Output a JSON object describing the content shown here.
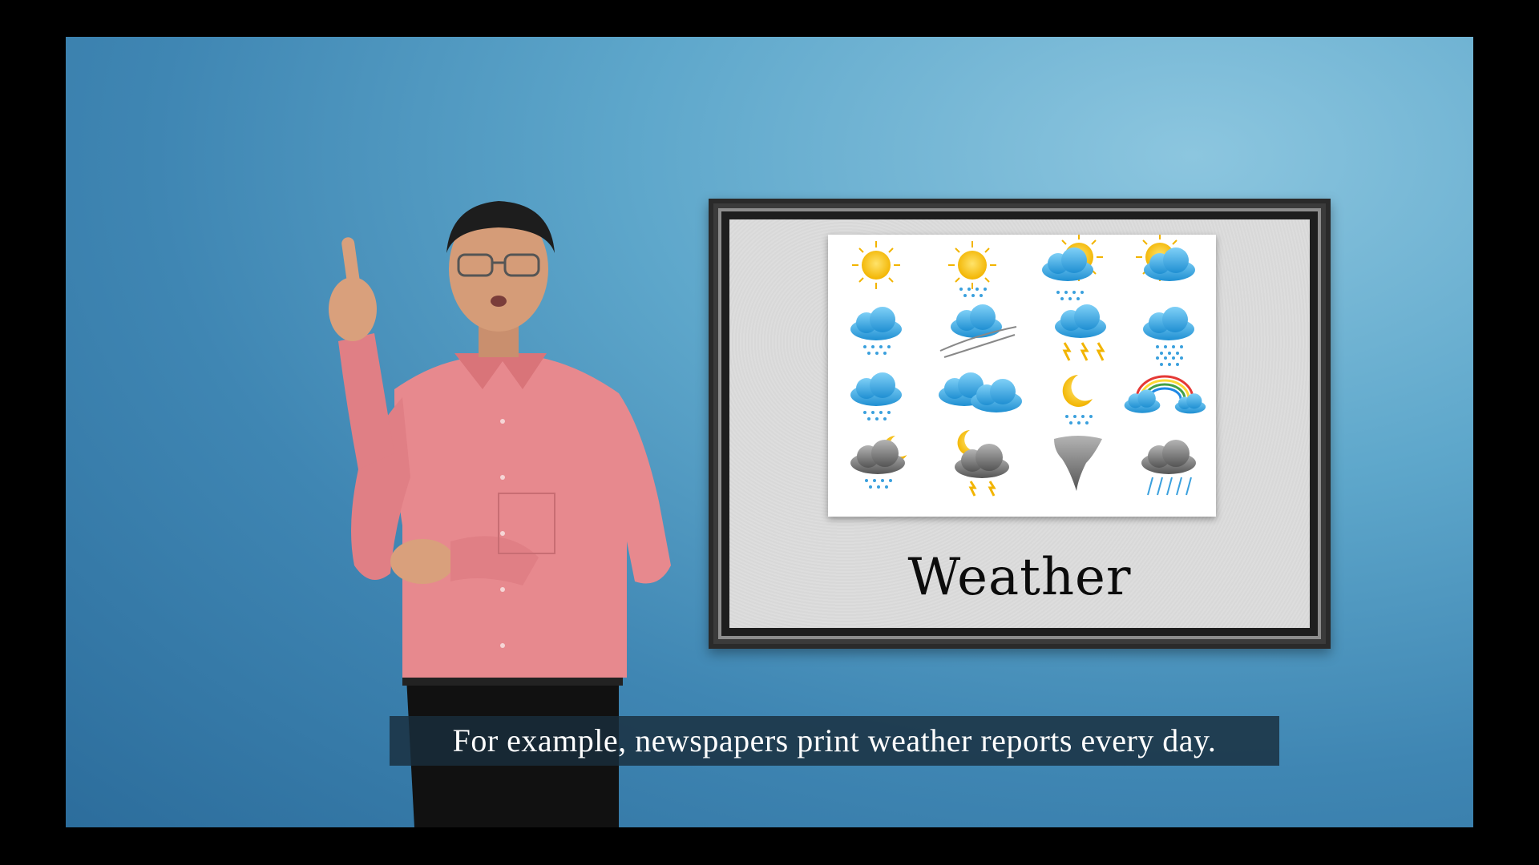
{
  "board": {
    "title": "Weather",
    "icons": [
      "sun-icon",
      "sun-snow-icon",
      "sun-cloud-snow-icon",
      "sun-cloud-icon",
      "cloud-rain-icon",
      "cloud-wind-icon",
      "cloud-lightning-icon",
      "cloud-rain-heavy-icon",
      "cloud-snow-icon",
      "clouds-icon",
      "moon-snow-icon",
      "rainbow-cloud-icon",
      "moon-dark-cloud-rain-icon",
      "moon-storm-cloud-icon",
      "tornado-icon",
      "dark-cloud-heavy-rain-icon"
    ]
  },
  "caption": {
    "text": "For example, newspapers print weather reports every day."
  },
  "colors": {
    "background": "#5ea7cb",
    "shirt": "#e58b8f",
    "sun": "#f6c21c",
    "cloud": "#3aa7e0"
  }
}
